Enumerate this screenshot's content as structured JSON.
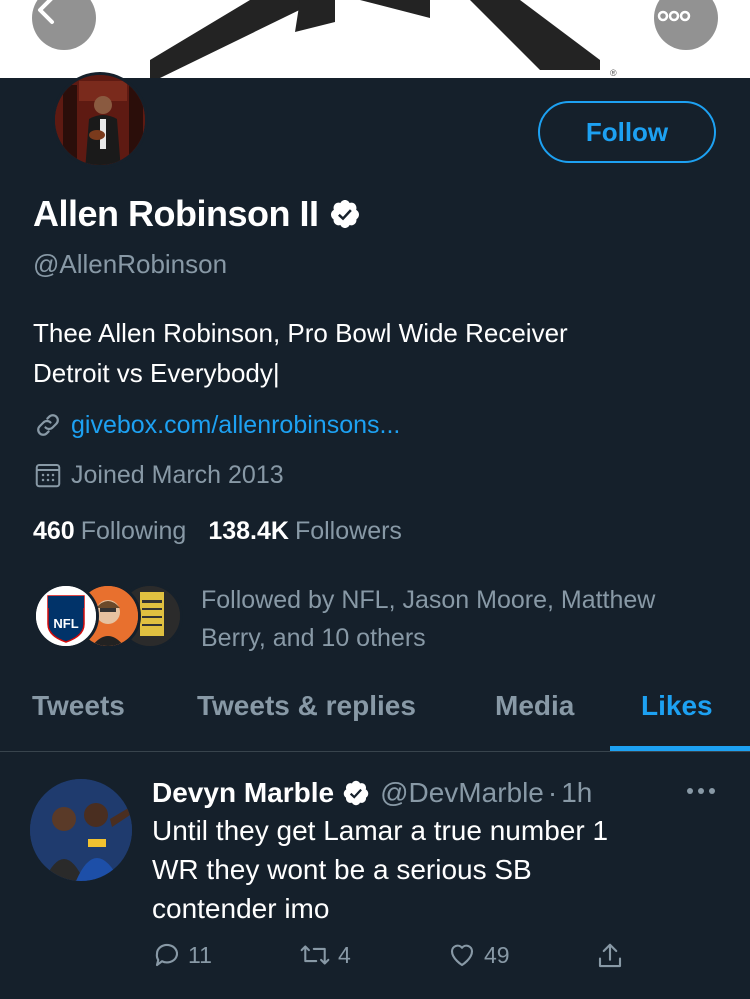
{
  "profile": {
    "name": "Allen Robinson II",
    "handle": "@AllenRobinson",
    "bio_line1": "Thee Allen Robinson, Pro Bowl Wide Receiver",
    "bio_line2": "Detroit vs Everybody|",
    "link": "givebox.com/allenrobinsons...",
    "joined": "Joined March 2013",
    "following_count": "460",
    "following_label": "Following",
    "followers_count": "138.4K",
    "followers_label": "Followers",
    "followed_by_line1": "Followed by NFL, Jason Moore, Matthew",
    "followed_by_line2": "Berry, and 10 others",
    "follow_label": "Follow",
    "nfl_badge": "NFL",
    "banner_mark": "®"
  },
  "tabs": [
    {
      "label": "Tweets"
    },
    {
      "label": "Tweets & replies"
    },
    {
      "label": "Media"
    },
    {
      "label": "Likes"
    }
  ],
  "tweet": {
    "name": "Devyn Marble",
    "handle": "@DevMarble",
    "separator": "·",
    "time": "1h",
    "text_line1": "Until they get Lamar a true number 1",
    "text_line2": "WR they wont be a serious SB",
    "text_line3": "contender imo",
    "replies": "11",
    "retweets": "4",
    "likes": "49"
  },
  "colors": {
    "background": "#15202b",
    "accent": "#1da1f2",
    "secondary_text": "#8899a6",
    "divider": "#38444d"
  }
}
